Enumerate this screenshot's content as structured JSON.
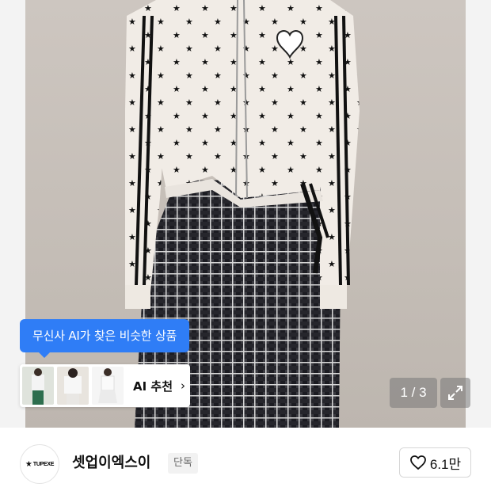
{
  "product": {
    "image_alt": "",
    "image_count_label": "1 / 3"
  },
  "ai_recommend": {
    "tooltip": "무신사 AI가 찾은 비슷한 상품",
    "button_label": "AI 추천",
    "chevron": "›"
  },
  "brand": {
    "logo_text": "TUPEXE",
    "name": "셋업이엑스이",
    "badge": "단독"
  },
  "like": {
    "count": "6.1만"
  },
  "icons": {
    "expand": "expand-icon",
    "heart": "heart-icon",
    "chevron": "chevron-right-icon",
    "logo_star": "star-icon"
  },
  "colors": {
    "accent": "#2f7df6",
    "badge_bg": "#f2f2f2"
  }
}
